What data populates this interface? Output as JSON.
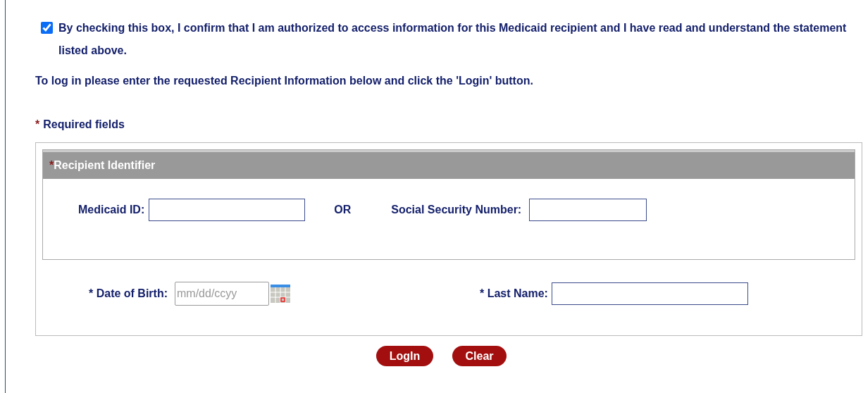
{
  "consent": {
    "checked": true,
    "text": "By checking this box, I confirm that I am authorized to access information for this Medicaid recipient and I have read and understand the statement listed above."
  },
  "instruction": "To log in please enter the requested Recipient Information below and click the 'Login' button.",
  "required_note": {
    "marker": "*",
    "text": "Required fields"
  },
  "identifier_section": {
    "marker": "*",
    "title": "Recipient Identifier",
    "medicaid_id": {
      "label": "Medicaid ID:"
    },
    "separator": "OR",
    "ssn": {
      "label": "Social Security Number:"
    }
  },
  "date_of_birth": {
    "label": "* Date of Birth:",
    "placeholder": "mm/dd/ccyy"
  },
  "last_name": {
    "label": "* Last Name:"
  },
  "buttons": [
    "LogIn",
    "Clear"
  ]
}
